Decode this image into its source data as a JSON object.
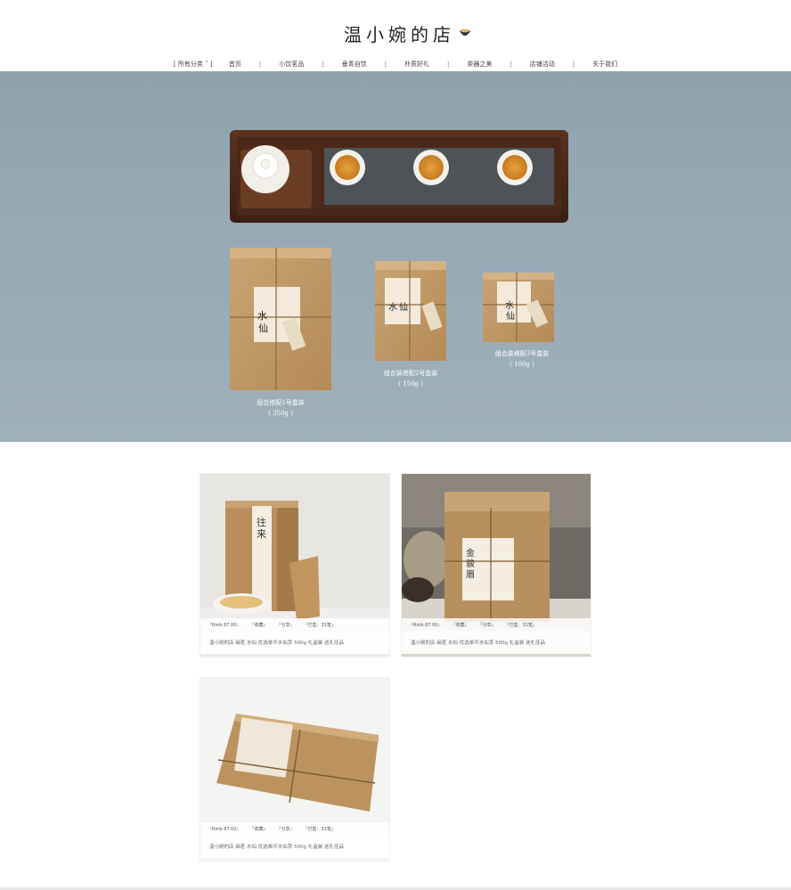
{
  "header": {
    "shop_name": "温小婉的店"
  },
  "nav": {
    "items": [
      {
        "label": "[ 所有分类 ˅ ]"
      },
      {
        "label": "首页"
      },
      {
        "label": "小饮茗品"
      },
      {
        "label": "垂青自饮"
      },
      {
        "label": "朴质好礼"
      },
      {
        "label": "茶器之美"
      },
      {
        "label": "店铺活动"
      },
      {
        "label": "关于我们"
      }
    ],
    "separator": "|"
  },
  "hero": {
    "box_label_char1": "水",
    "box_label_char2": "仙",
    "captions": [
      {
        "name": "组合搭配1号盒装",
        "weight": "( 350g )"
      },
      {
        "name": "组合装搭配2号盒装",
        "weight": "( 150g )"
      },
      {
        "name": "组合装搭配3号盒装",
        "weight": "( 100g )"
      }
    ]
  },
  "products": [
    {
      "price": "『Rmb 87.00』",
      "fav": "『收藏』",
      "share": "『分享』",
      "sold": "『已售：31笔』",
      "title": "温小婉的店 闽茗 水仙 优选单平水仙芽 500g 礼盒装 送礼佳品",
      "box_text": "往来"
    },
    {
      "price": "『Rmb 87.00』",
      "fav": "『收藏』",
      "share": "『分享』",
      "sold": "『已售：31笔』",
      "title": "温小婉的店 闽茗 水仙 优选单平水仙芽 500g 礼盒装 送礼佳品",
      "box_text": "金骏眉"
    },
    {
      "price": "『Rmb 87.00』",
      "fav": "『收藏』",
      "share": "『分享』",
      "sold": "『已售：31笔』",
      "title": "温小婉的店 闽茗 水仙 优选单平水仙芽 500g 礼盒装 送礼佳品",
      "box_text": ""
    }
  ],
  "colors": {
    "kraft": "#c29a66",
    "tray": "#4a2a1a",
    "hero_bg": "#96a9b4",
    "tea": "#d8902a"
  }
}
